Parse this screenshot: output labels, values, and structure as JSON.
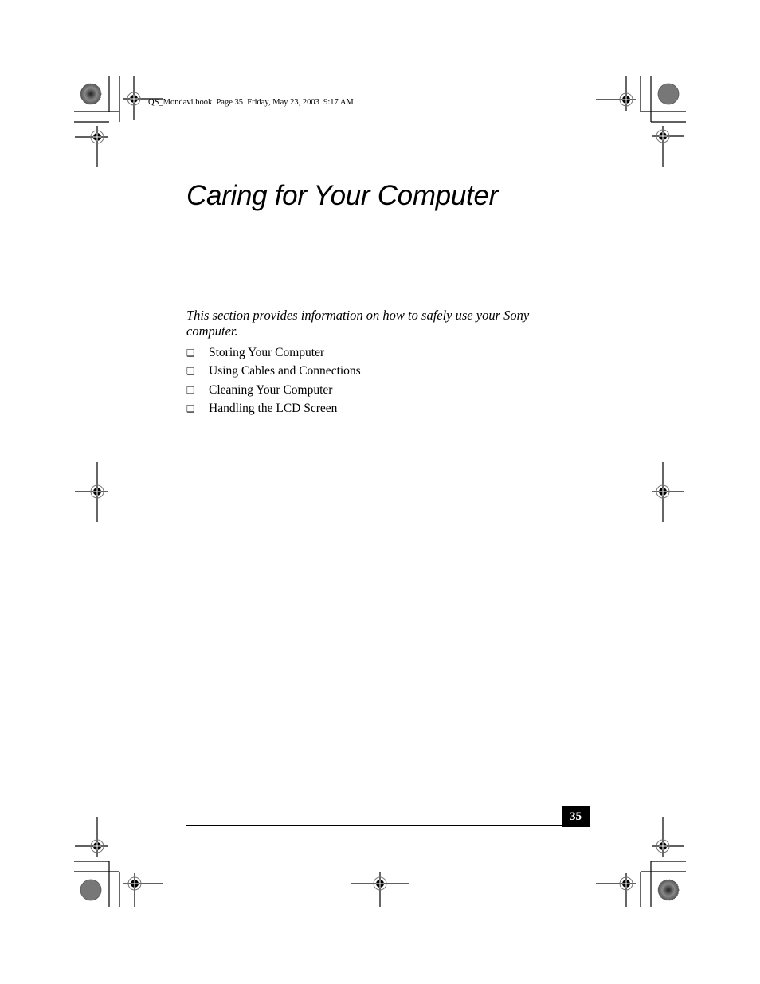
{
  "header": {
    "stamp": "QS_Mondavi.book  Page 35  Friday, May 23, 2003  9:17 AM"
  },
  "chapter": {
    "title": "Caring for Your Computer",
    "intro": "This section provides information on how to safely use your Sony computer.",
    "topics": [
      {
        "bullet": "❑",
        "label": "Storing Your Computer"
      },
      {
        "bullet": "❑",
        "label": "Using Cables and Connections"
      },
      {
        "bullet": "❑",
        "label": "Cleaning Your Computer"
      },
      {
        "bullet": "❑",
        "label": "Handling the LCD Screen"
      }
    ]
  },
  "footer": {
    "page_number": "35"
  },
  "print_marks": {
    "registration_icon": "registration-target-icon",
    "color_bar_icon": "printer-color-dot-icon",
    "crop_mark_icon": "crop-mark-icon"
  }
}
